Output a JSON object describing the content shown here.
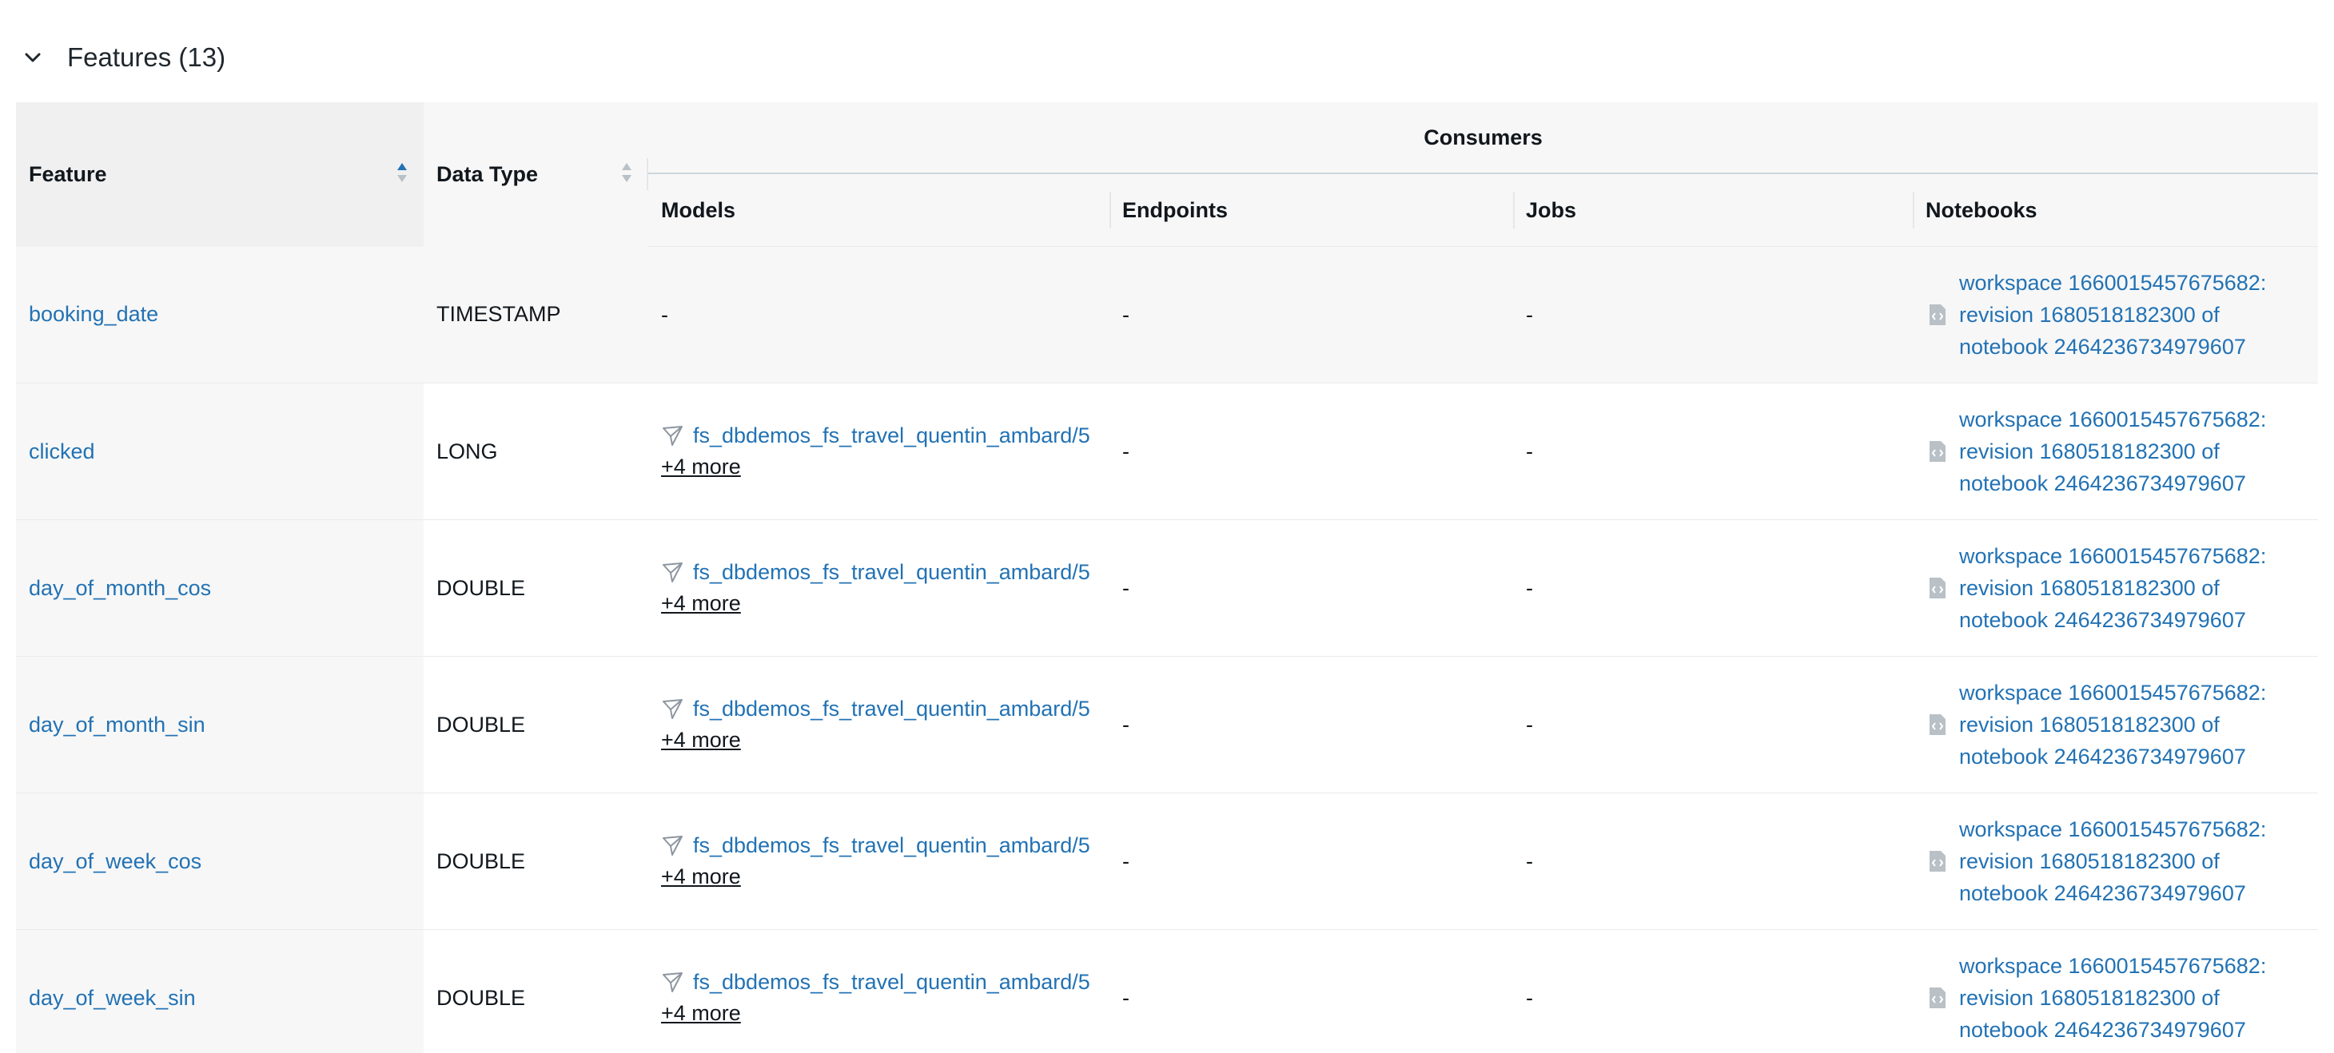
{
  "section": {
    "title": "Features (13)"
  },
  "table": {
    "headers": {
      "feature": "Feature",
      "data_type": "Data Type",
      "consumers": "Consumers",
      "models": "Models",
      "endpoints": "Endpoints",
      "jobs": "Jobs",
      "notebooks": "Notebooks"
    },
    "rows": [
      {
        "feature": "booking_date",
        "data_type": "TIMESTAMP",
        "model": "-",
        "more": "",
        "endpoints": "-",
        "jobs": "-",
        "notebook": "workspace 1660015457675682: revision 1680518182300 of notebook 2464236734979607"
      },
      {
        "feature": "clicked",
        "data_type": "LONG",
        "model": "fs_dbdemos_fs_travel_quentin_ambard/5",
        "more": "+4 more",
        "endpoints": "-",
        "jobs": "-",
        "notebook": "workspace 1660015457675682: revision 1680518182300 of notebook 2464236734979607"
      },
      {
        "feature": "day_of_month_cos",
        "data_type": "DOUBLE",
        "model": "fs_dbdemos_fs_travel_quentin_ambard/5",
        "more": "+4 more",
        "endpoints": "-",
        "jobs": "-",
        "notebook": "workspace 1660015457675682: revision 1680518182300 of notebook 2464236734979607"
      },
      {
        "feature": "day_of_month_sin",
        "data_type": "DOUBLE",
        "model": "fs_dbdemos_fs_travel_quentin_ambard/5",
        "more": "+4 more",
        "endpoints": "-",
        "jobs": "-",
        "notebook": "workspace 1660015457675682: revision 1680518182300 of notebook 2464236734979607"
      },
      {
        "feature": "day_of_week_cos",
        "data_type": "DOUBLE",
        "model": "fs_dbdemos_fs_travel_quentin_ambard/5",
        "more": "+4 more",
        "endpoints": "-",
        "jobs": "-",
        "notebook": "workspace 1660015457675682: revision 1680518182300 of notebook 2464236734979607"
      },
      {
        "feature": "day_of_week_sin",
        "data_type": "DOUBLE",
        "model": "fs_dbdemos_fs_travel_quentin_ambard/5",
        "more": "+4 more",
        "endpoints": "-",
        "jobs": "-",
        "notebook": "workspace 1660015457675682: revision 1680518182300 of notebook 2464236734979607"
      }
    ]
  },
  "icons": {
    "collapse": "chevron-down-icon",
    "sort": "sort-icon",
    "model": "model-icon",
    "notebook": "notebook-icon"
  },
  "colors": {
    "link": "#2272b4",
    "header_bg": "#f7f7f7",
    "sorted_header_bg": "#f0f0f0",
    "sort_active": "#2272b4"
  }
}
